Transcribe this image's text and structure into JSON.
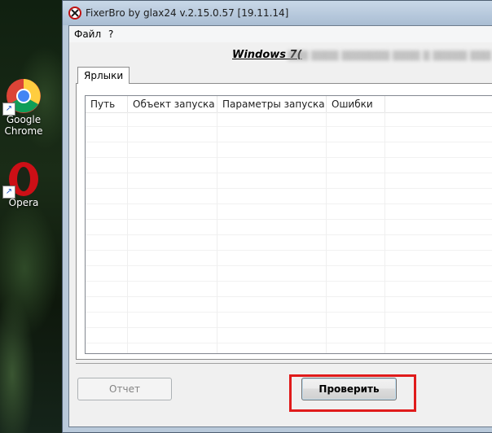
{
  "desktop": {
    "icons": [
      {
        "label_line1": "Google",
        "label_line2": "Chrome",
        "icon": "chrome-icon"
      },
      {
        "label_line1": "Opera",
        "icon": "opera-icon"
      }
    ]
  },
  "window": {
    "title": "FixerBro by glax24 v.2.15.0.57 [19.11.14]",
    "menu": [
      "Файл",
      "?"
    ],
    "os_label": "Windows 7",
    "os_label_suffix": "(",
    "tabs": [
      {
        "label": "Ярлыки",
        "active": true
      }
    ],
    "table": {
      "columns": [
        "Путь",
        "Объект запуска",
        "Параметры запуска",
        "Ошибки"
      ],
      "rows": []
    },
    "buttons": {
      "report": {
        "label": "Отчет",
        "enabled": false
      },
      "check": {
        "label": "Проверить",
        "enabled": true,
        "highlighted": true
      }
    }
  },
  "colors": {
    "highlight": "#e01b1b",
    "titlebar": "#b9c9da"
  }
}
